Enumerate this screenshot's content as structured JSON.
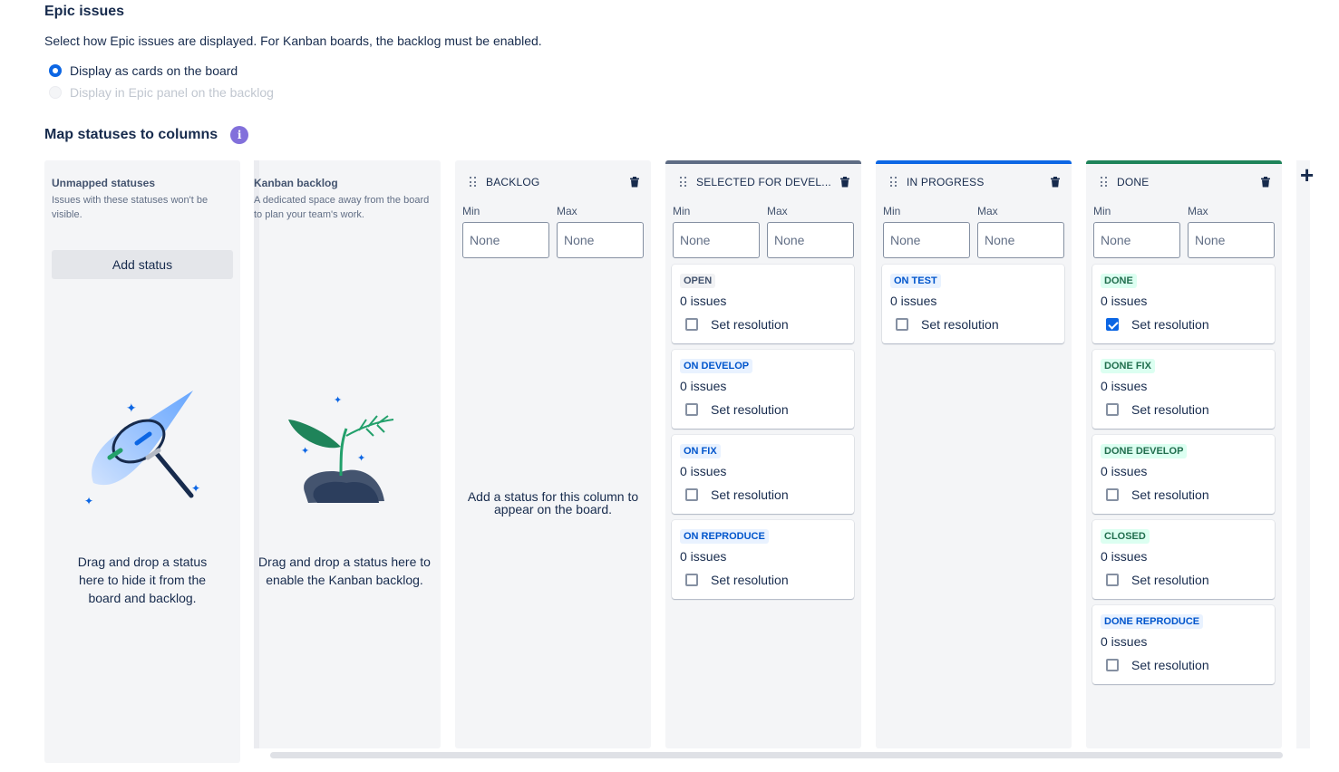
{
  "epic": {
    "title": "Epic issues",
    "description": "Select how Epic issues are displayed. For Kanban boards, the backlog must be enabled.",
    "option_cards": "Display as cards on the board",
    "option_panel": "Display in Epic panel on the backlog"
  },
  "map": {
    "title": "Map statuses to columns",
    "info_icon": "i"
  },
  "unmapped": {
    "title": "Unmapped statuses",
    "description": "Issues with these statuses won't be visible.",
    "add_button": "Add status",
    "drop_text": "Drag and drop a status here to hide it from the board and backlog."
  },
  "kanban_backlog": {
    "title": "Kanban backlog",
    "description": "A dedicated space away from the board to plan your team's work.",
    "drop_text": "Drag and drop a status here to enable the Kanban backlog."
  },
  "labels": {
    "min": "Min",
    "max": "Max",
    "none": "None",
    "set_resolution": "Set resolution",
    "empty_column": "Add a status for this column to appear on the board."
  },
  "columns": [
    {
      "name": "BACKLOG",
      "statuses": []
    },
    {
      "name": "SELECTED FOR DEVEL...",
      "statuses": [
        {
          "name": "OPEN",
          "count": "0 issues",
          "resolution": false,
          "color": "gray"
        },
        {
          "name": "ON DEVELOP",
          "count": "0 issues",
          "resolution": false,
          "color": "blue"
        },
        {
          "name": "ON FIX",
          "count": "0 issues",
          "resolution": false,
          "color": "blue"
        },
        {
          "name": "ON REPRODUCE",
          "count": "0 issues",
          "resolution": false,
          "color": "blue"
        }
      ]
    },
    {
      "name": "IN PROGRESS",
      "statuses": [
        {
          "name": "ON TEST",
          "count": "0 issues",
          "resolution": false,
          "color": "blue"
        }
      ]
    },
    {
      "name": "DONE",
      "statuses": [
        {
          "name": "DONE",
          "count": "0 issues",
          "resolution": true,
          "color": "green"
        },
        {
          "name": "DONE FIX",
          "count": "0 issues",
          "resolution": false,
          "color": "green"
        },
        {
          "name": "DONE DEVELOP",
          "count": "0 issues",
          "resolution": false,
          "color": "green"
        },
        {
          "name": "CLOSED",
          "count": "0 issues",
          "resolution": false,
          "color": "green"
        },
        {
          "name": "DONE REPRODUCE",
          "count": "0 issues",
          "resolution": false,
          "color": "blue"
        }
      ]
    }
  ],
  "add_column_icon": "+",
  "colors": {
    "accent": "#0c66e4",
    "info": "#8270db",
    "todo_bar": "#5e6c84",
    "progress_bar": "#0c66e4",
    "done_bar": "#1f845a"
  }
}
